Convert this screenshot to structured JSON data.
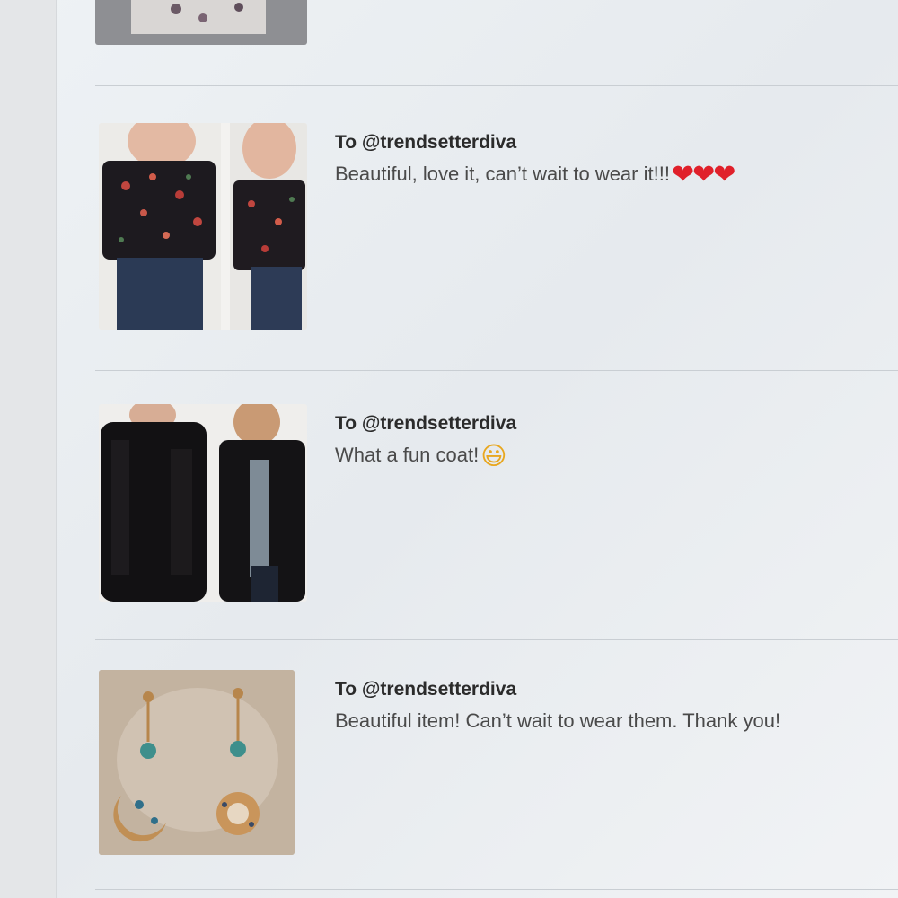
{
  "reviews": [
    {
      "recipient": "To @trendsetterdiva",
      "comment": "Beautiful, love it, can’t wait to wear it!!!",
      "emoji": "❤❤❤",
      "emoji_name": "heart-emoji"
    },
    {
      "recipient": "To @trendsetterdiva",
      "comment": "What a fun coat!",
      "emoji": "😃",
      "emoji_name": "smiley-emoji"
    },
    {
      "recipient": "To @trendsetterdiva",
      "comment": "Beautiful item! Can’t wait to wear them. Thank you!",
      "emoji": "",
      "emoji_name": ""
    }
  ],
  "colors": {
    "heart": "#e0202a",
    "text_bold": "#2b2b2b",
    "text_body": "#4a4a4a",
    "divider": "#c9ced3"
  }
}
